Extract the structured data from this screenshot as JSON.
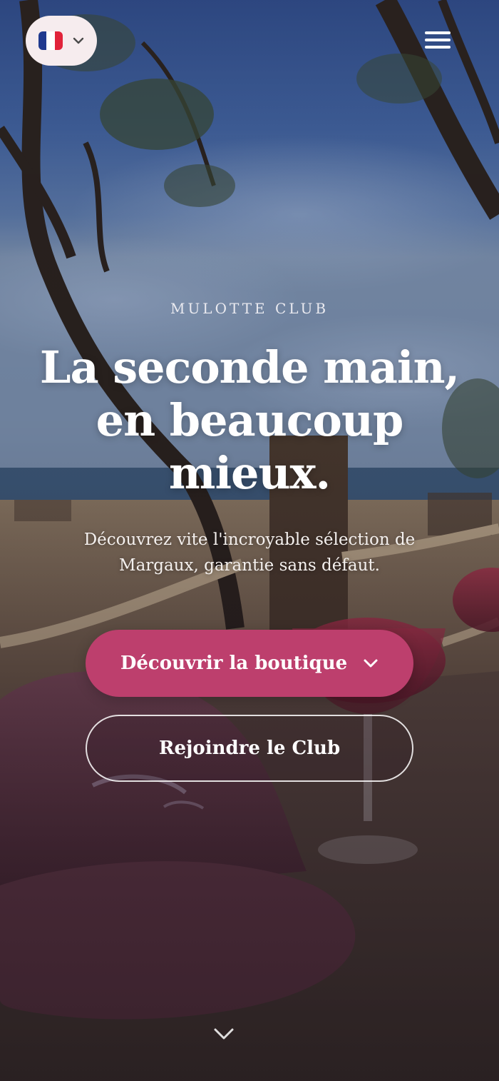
{
  "header": {
    "language": {
      "current": "FR",
      "flag_icon": "flag-france-icon",
      "chevron_icon": "chevron-down-icon"
    },
    "menu_icon": "hamburger-menu-icon"
  },
  "hero": {
    "eyebrow": "MULOTTE CLUB",
    "headline": "La seconde main, en beaucoup mieux.",
    "subtitle": "Découvrez vite l'incroyable sélection de Margaux, garantie sans défaut.",
    "primary_cta": {
      "label": "Découvrir la boutique",
      "icon": "chevron-down-icon"
    },
    "secondary_cta": {
      "label": "Rejoindre le Club"
    },
    "scroll_icon": "chevron-down-icon"
  },
  "colors": {
    "accent": "#bd3f6d",
    "lang_pill": "#f6ecee",
    "text": "#ffffff"
  }
}
